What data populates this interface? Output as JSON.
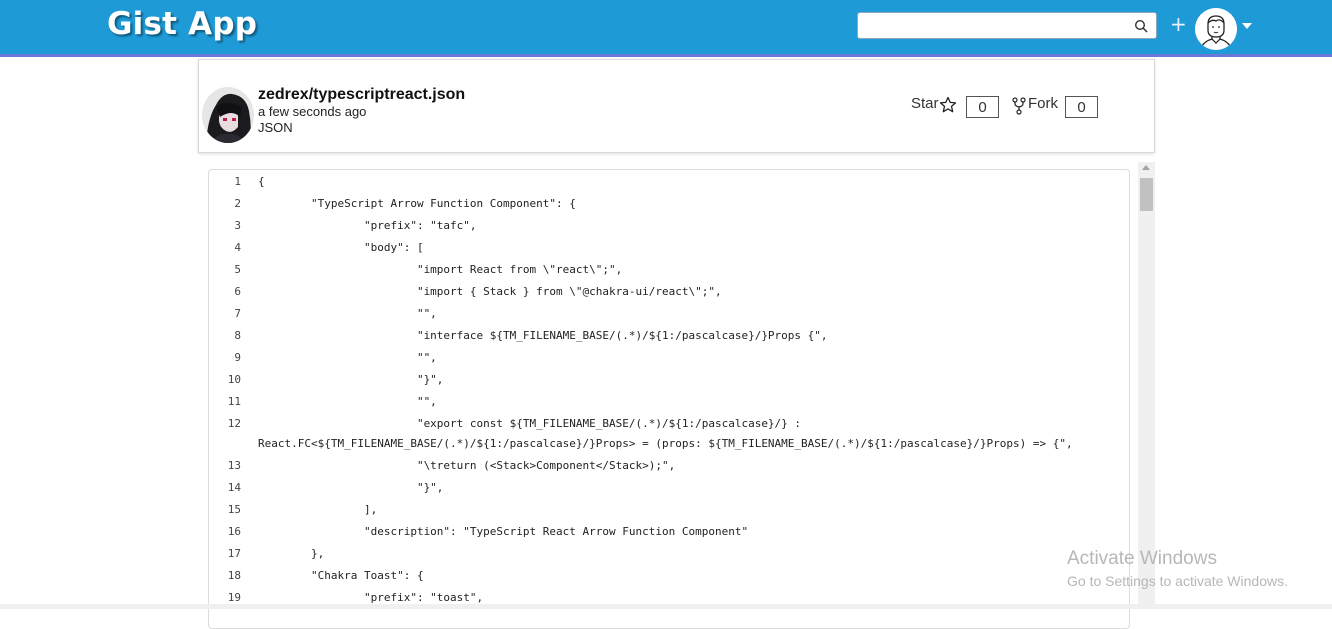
{
  "header": {
    "app_title": "Gist App",
    "search_value": "",
    "plus_glyph": "+",
    "bg_color": "#1e9bd7"
  },
  "gist": {
    "title": "zedrex/typescriptreact.json",
    "time": "a few seconds ago",
    "language": "JSON",
    "star_label": "Star",
    "star_count": "0",
    "fork_label": "Fork",
    "fork_count": "0"
  },
  "code": {
    "lines": [
      {
        "n": "1",
        "t": "{"
      },
      {
        "n": "2",
        "t": "        \"TypeScript Arrow Function Component\": {"
      },
      {
        "n": "3",
        "t": "                \"prefix\": \"tafc\","
      },
      {
        "n": "4",
        "t": "                \"body\": ["
      },
      {
        "n": "5",
        "t": "                        \"import React from \\\"react\\\";\","
      },
      {
        "n": "6",
        "t": "                        \"import { Stack } from \\\"@chakra-ui/react\\\";\","
      },
      {
        "n": "7",
        "t": "                        \"\","
      },
      {
        "n": "8",
        "t": "                        \"interface ${TM_FILENAME_BASE/(.*)/${1:/pascalcase}/}Props {\","
      },
      {
        "n": "9",
        "t": "                        \"\","
      },
      {
        "n": "10",
        "t": "                        \"}\","
      },
      {
        "n": "11",
        "t": "                        \"\","
      },
      {
        "n": "12",
        "t": "                        \"export const ${TM_FILENAME_BASE/(.*)/${1:/pascalcase}/} :"
      },
      {
        "n": "",
        "t": "React.FC<${TM_FILENAME_BASE/(.*)/${1:/pascalcase}/}Props> = (props: ${TM_FILENAME_BASE/(.*)/${1:/pascalcase}/}Props) => {\","
      },
      {
        "n": "13",
        "t": "                        \"\\treturn (<Stack>Component</Stack>);\","
      },
      {
        "n": "14",
        "t": "                        \"}\","
      },
      {
        "n": "15",
        "t": "                ],"
      },
      {
        "n": "16",
        "t": "                \"description\": \"TypeScript React Arrow Function Component\""
      },
      {
        "n": "17",
        "t": "        },"
      },
      {
        "n": "18",
        "t": "        \"Chakra Toast\": {"
      },
      {
        "n": "19",
        "t": "                \"prefix\": \"toast\","
      }
    ]
  },
  "watermark": {
    "title": "Activate Windows",
    "subtitle": "Go to Settings to activate Windows."
  }
}
